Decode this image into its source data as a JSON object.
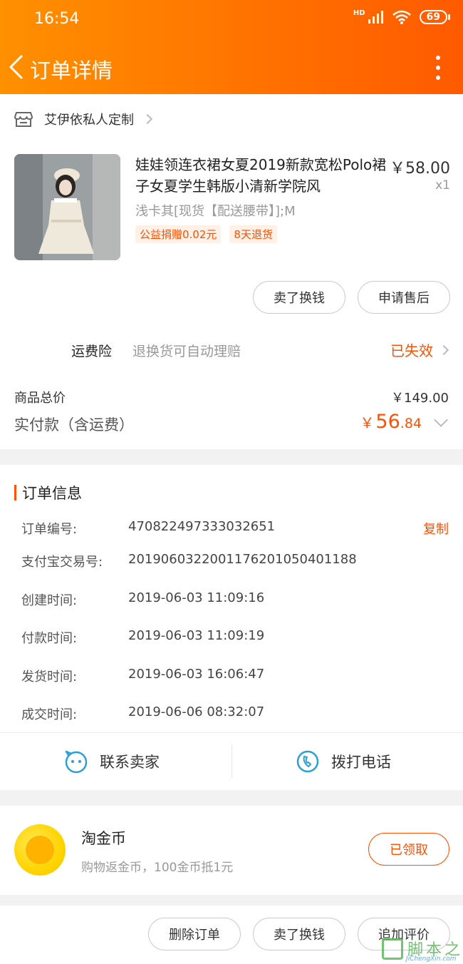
{
  "status_bar": {
    "time": "16:54",
    "network": "HD",
    "battery": "69"
  },
  "nav": {
    "title": "订单详情"
  },
  "shop": {
    "name": "艾伊依私人定制"
  },
  "product": {
    "title": "娃娃领连衣裙女夏2019新款宽松Polo裙子女夏学生韩版小清新学院风",
    "price": "￥58.00",
    "qty": "x1",
    "spec": "浅卡其[现货【配送腰带】];M",
    "tags": [
      "公益捐赠0.02元",
      "8天退货"
    ]
  },
  "item_actions": {
    "sell": "卖了换钱",
    "after_sale": "申请售后"
  },
  "insurance": {
    "label": "运费险",
    "desc": "退换货可自动理赔",
    "status": "已失效"
  },
  "totals": {
    "total_label": "商品总价",
    "total_value": "￥149.00",
    "paid_label": "实付款（含运费）",
    "paid_symbol": "￥",
    "paid_integer": "56",
    "paid_decimal": ".84"
  },
  "order_info": {
    "title": "订单信息",
    "copy": "复制",
    "rows": [
      {
        "key": "订单编号:",
        "value": "470822497333032651"
      },
      {
        "key": "支付宝交易号:",
        "value": "2019060322001176201050401188"
      },
      {
        "key": "创建时间:",
        "value": "2019-06-03 11:09:16"
      },
      {
        "key": "付款时间:",
        "value": "2019-06-03 11:09:19"
      },
      {
        "key": "发货时间:",
        "value": "2019-06-03 16:06:47"
      },
      {
        "key": "成交时间:",
        "value": "2019-06-06 08:32:07"
      }
    ]
  },
  "contact": {
    "seller": "联系卖家",
    "phone": "拨打电话"
  },
  "coin": {
    "title": "淘金币",
    "desc": "购物返金币，100金币抵1元",
    "button": "已领取"
  },
  "bottom_actions": {
    "delete": "删除订单",
    "sell": "卖了换钱",
    "review": "追加评价"
  },
  "watermark": {
    "text": "脚本之家",
    "sub": "JiChengXin.com"
  },
  "colors": {
    "accent": "#ff5000",
    "header_start": "#ff9000",
    "header_end": "#ff5a00"
  }
}
